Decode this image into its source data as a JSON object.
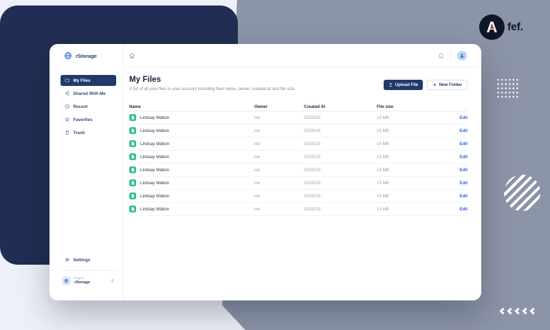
{
  "colors": {
    "navy_shape": "#1f2e52",
    "gray_shape": "#8c94a8",
    "accent_navy": "#21396b",
    "link_blue": "#2563eb",
    "file_green": "#35c08c",
    "badge_red": "#e23b3b"
  },
  "brand": {
    "badge_letter": "A",
    "badge_word": "fef."
  },
  "icons": {
    "logo": "globe-icon",
    "nav": [
      "folder-icon",
      "share-icon",
      "clock-icon",
      "star-icon",
      "trash-icon"
    ],
    "settings": "gear-icon",
    "workspace_avatar": "cube-icon",
    "workspace_caret": "up-down-chevron-icon",
    "topbar": [
      "home-icon",
      "bell-icon",
      "user-avatar-icon"
    ],
    "upload": "upload-arrow-icon",
    "new_folder": "plus-icon",
    "file_row": "file-document-icon",
    "decor": [
      "dot-grid",
      "striped-circle",
      "chevrons-left"
    ]
  },
  "app": {
    "logo": "rStorage",
    "sidebar": {
      "items": [
        {
          "label": "My Files",
          "active": true
        },
        {
          "label": "Shared With Me",
          "active": false
        },
        {
          "label": "Recent",
          "active": false
        },
        {
          "label": "Favorites",
          "active": false
        },
        {
          "label": "Trash",
          "active": false
        }
      ],
      "settings": "Settings",
      "workspace": {
        "kicker": "Project",
        "name": "rStorage"
      }
    },
    "page": {
      "title": "My Files",
      "subtitle": "A list of all your files in your account including their name, owner, created at and file size.",
      "buttons": {
        "upload": "Upload File",
        "new_folder": "New Folder"
      }
    },
    "table": {
      "headers": {
        "name": "Name",
        "owner": "Owner",
        "created": "Created At",
        "size": "File size"
      },
      "rows": [
        {
          "name": "Lindsay Walton",
          "owner": "me",
          "created": "20/20/23",
          "size": "15 MB",
          "action": "Edit"
        },
        {
          "name": "Lindsay Walton",
          "owner": "me",
          "created": "20/20/23",
          "size": "15 MB",
          "action": "Edit"
        },
        {
          "name": "Lindsay Walton",
          "owner": "me",
          "created": "20/20/23",
          "size": "15 MB",
          "action": "Edit"
        },
        {
          "name": "Lindsay Walton",
          "owner": "me",
          "created": "20/20/23",
          "size": "15 MB",
          "action": "Edit"
        },
        {
          "name": "Lindsay Walton",
          "owner": "me",
          "created": "20/20/23",
          "size": "15 MB",
          "action": "Edit"
        },
        {
          "name": "Lindsay Walton",
          "owner": "me",
          "created": "20/20/23",
          "size": "15 MB",
          "action": "Edit"
        },
        {
          "name": "Lindsay Walton",
          "owner": "me",
          "created": "20/20/23",
          "size": "15 MB",
          "action": "Edit"
        },
        {
          "name": "Lindsay Walton",
          "owner": "me",
          "created": "20/20/23",
          "size": "15 MB",
          "action": "Edit"
        }
      ]
    }
  }
}
